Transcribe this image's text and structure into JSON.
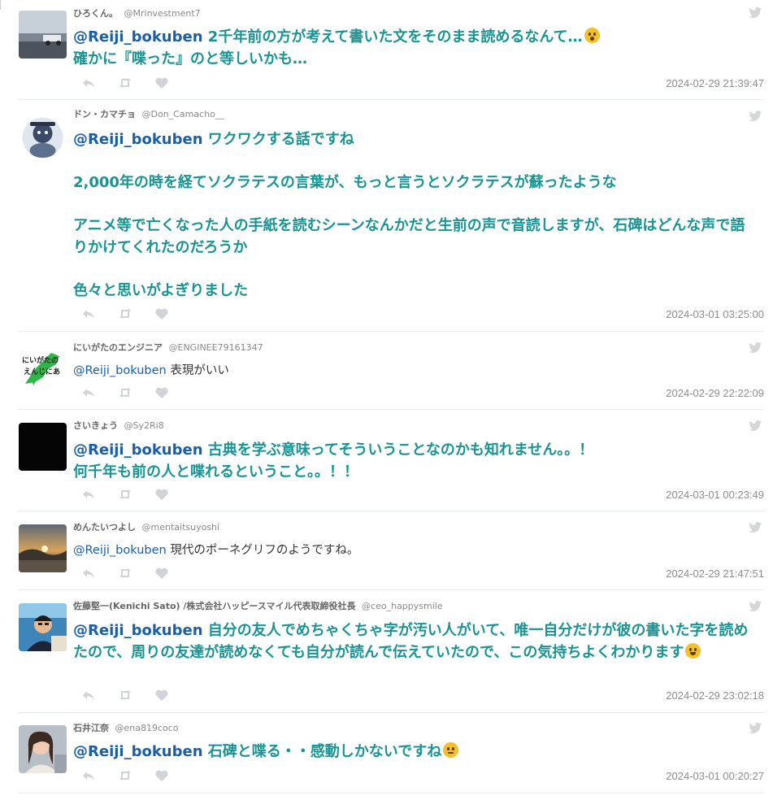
{
  "tweets": [
    {
      "name": "ひろくん。",
      "handle": "@Mrinvestment7",
      "mention": "@Reiji_bokuben",
      "text": " 2千年前の方が考えて書いた文をそのまま読めるなんて…",
      "text_after_emoji": "\n確かに『喋った』のと等しいかも…",
      "emoji": "astonished-face",
      "time": "2024-02-29 21:39:47"
    },
    {
      "name": "ドン・カマチョ",
      "handle": "@Don_Camacho__",
      "mention": "@Reiji_bokuben",
      "text": " ワクワクする話ですね\n\n2,000年の時を経てソクラテスの言葉が、もっと言うとソクラテスが蘇ったような\n\nアニメ等で亡くなった人の手紙を読むシーンなんかだと生前の声で音読しますが、石碑はどんな声で語りかけてくれたのだろうか\n\n色々と思いがよぎりました",
      "time": "2024-03-01 03:25:00"
    },
    {
      "name": "にいがたのエンジニア",
      "handle": "@ENGINEE79161347",
      "mention": "@Reiji_bokuben",
      "text": " 表現がいい",
      "avatar_text": "にいがたのえんじにあ",
      "time": "2024-02-29 22:22:09"
    },
    {
      "name": "さいきょう",
      "handle": "@Sy2Ri8",
      "mention": "@Reiji_bokuben",
      "text": " 古典を学ぶ意味ってそういうことなのかも知れません。。！\n何千年も前の人と喋れるということ。。！！",
      "time": "2024-03-01 00:23:49"
    },
    {
      "name": "めんたいつよし",
      "handle": "@mentaitsuyoshi",
      "mention": "@Reiji_bokuben",
      "text": " 現代のポーネグリフのようですね。",
      "time": "2024-02-29 21:47:51"
    },
    {
      "name": "佐藤堅一(Kenichi Sato) /株式会社ハッピースマイル代表取締役社長",
      "handle": "@ceo_happysmile",
      "mention": "@Reiji_bokuben",
      "text": " 自分の友人でめちゃくちゃ字が汚い人がいて、唯一自分だけが彼の書いた字を読めたので、周りの友達が読めなくても自分が読んで伝えていたので、この気持ちよくわかります",
      "emoji": "grinning-face",
      "time": "2024-02-29 23:02:18"
    },
    {
      "name": "石井江奈",
      "handle": "@ena819coco",
      "mention": "@Reiji_bokuben",
      "text": " 石碑と喋る・・感動しかないですね",
      "emoji": "face-with-rolling-eyes",
      "time": "2024-03-01 00:20:27"
    }
  ],
  "icons": {
    "reply": "reply-icon",
    "retweet": "retweet-icon",
    "like": "heart-icon",
    "platform": "twitter-bird-icon"
  },
  "colors": {
    "emphasis_text": "#199494",
    "mention": "#1b5ea8",
    "timestamp": "#8e8e8e",
    "icon_gray": "#d0d4d8"
  }
}
